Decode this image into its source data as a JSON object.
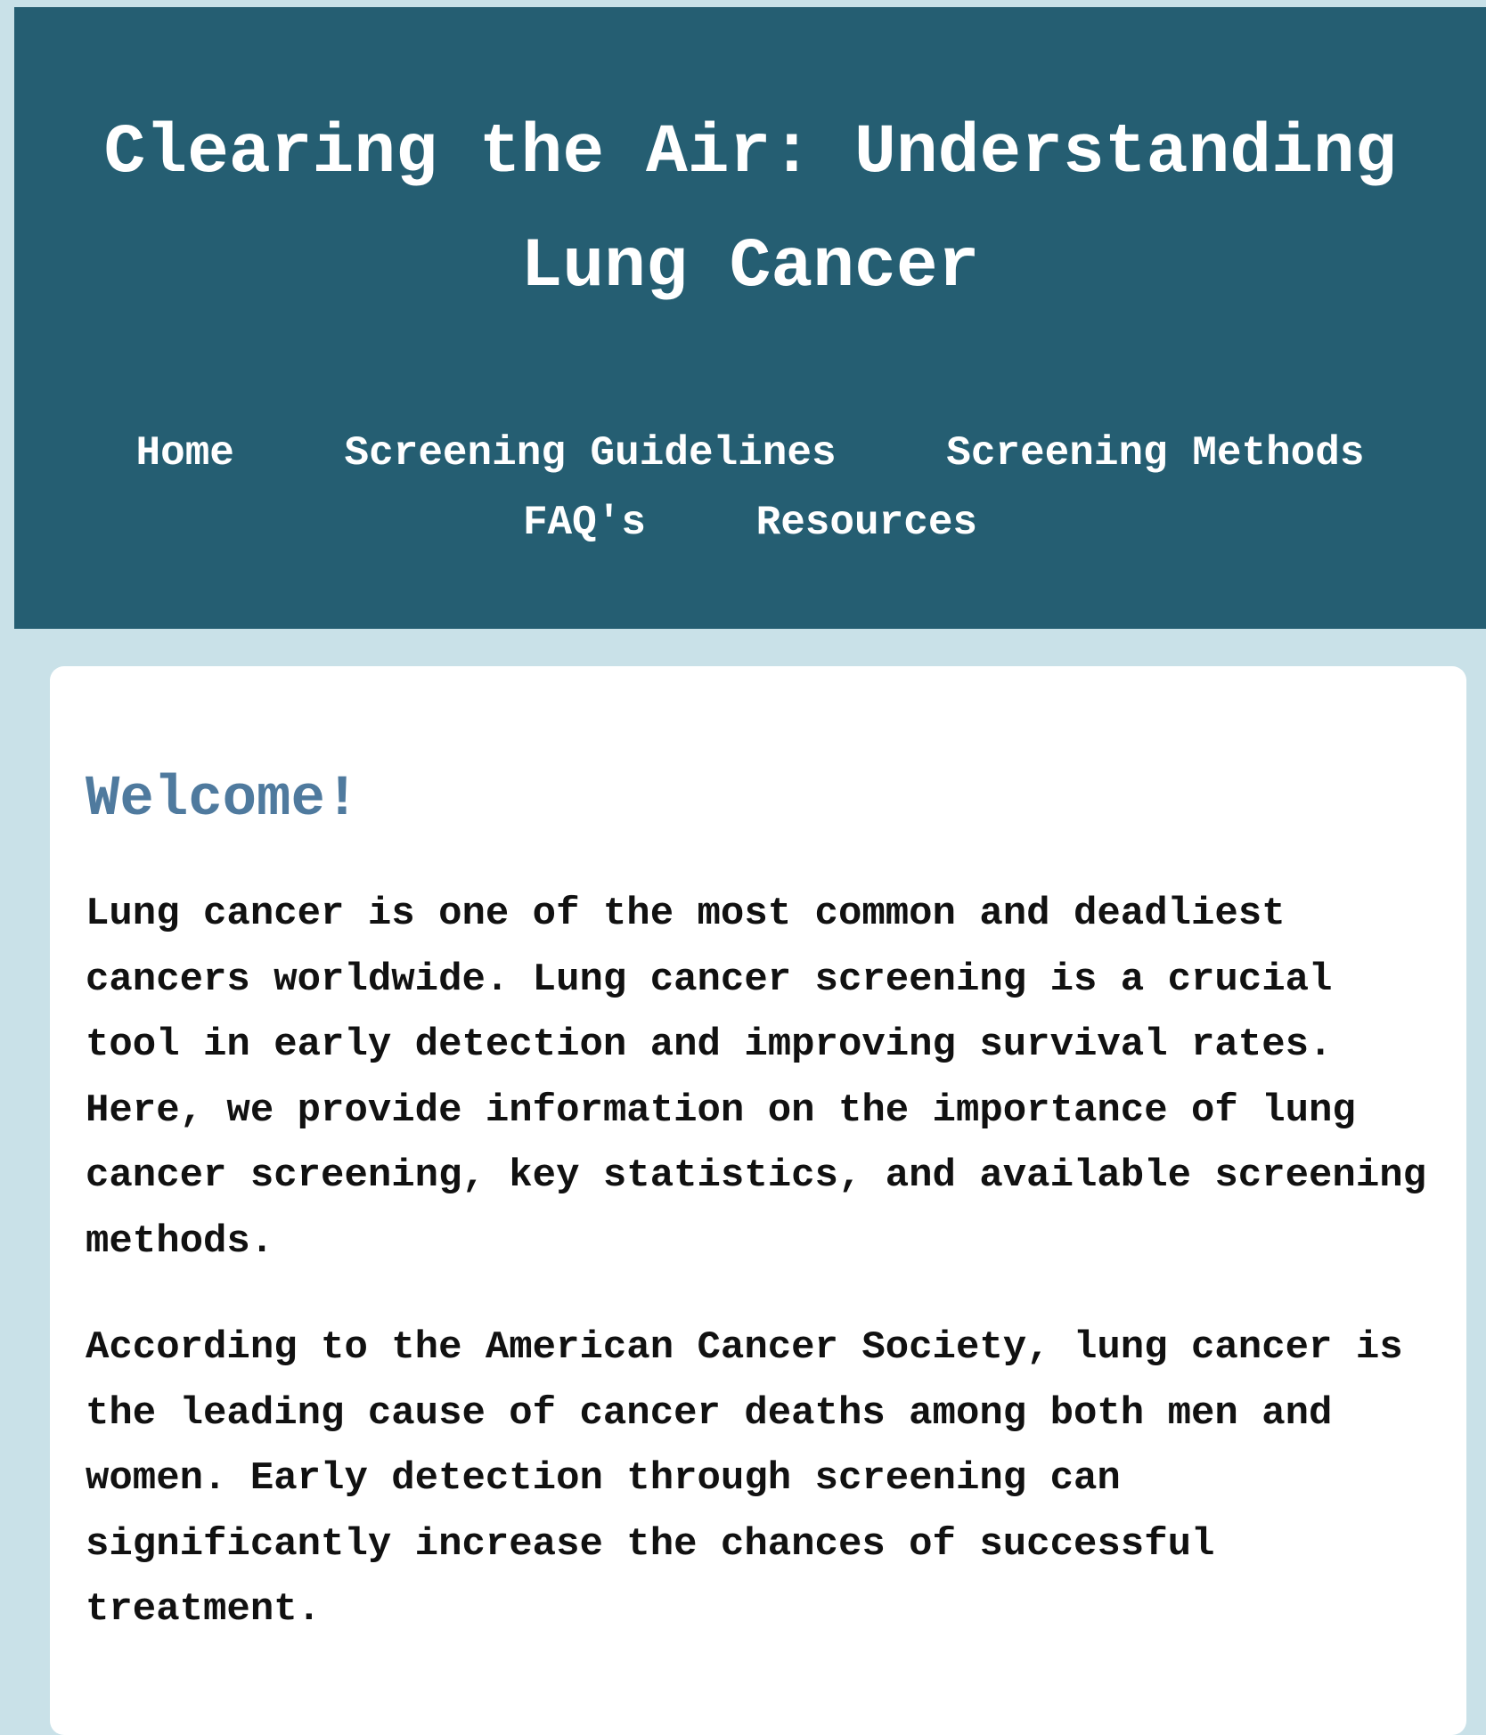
{
  "header": {
    "title": "Clearing the Air: Understanding Lung Cancer",
    "nav": [
      {
        "label": "Home"
      },
      {
        "label": "Screening Guidelines"
      },
      {
        "label": "Screening Methods"
      },
      {
        "label": "FAQ's"
      },
      {
        "label": "Resources"
      }
    ]
  },
  "main": {
    "heading": "Welcome!",
    "paragraphs": [
      "Lung cancer is one of the most common and deadliest cancers worldwide. Lung cancer screening is a crucial tool in early detection and improving survival rates. Here, we provide information on the importance of lung cancer screening, key statistics, and available screening methods.",
      "According to the American Cancer Society, lung cancer is the leading cause of cancer deaths among both men and women. Early detection through screening can significantly increase the chances of successful treatment."
    ]
  },
  "colors": {
    "page_background": "#c9e1e8",
    "header_background": "#255e72",
    "header_text": "#ffffff",
    "heading_accent": "#4f7a9e",
    "card_background": "#ffffff"
  }
}
